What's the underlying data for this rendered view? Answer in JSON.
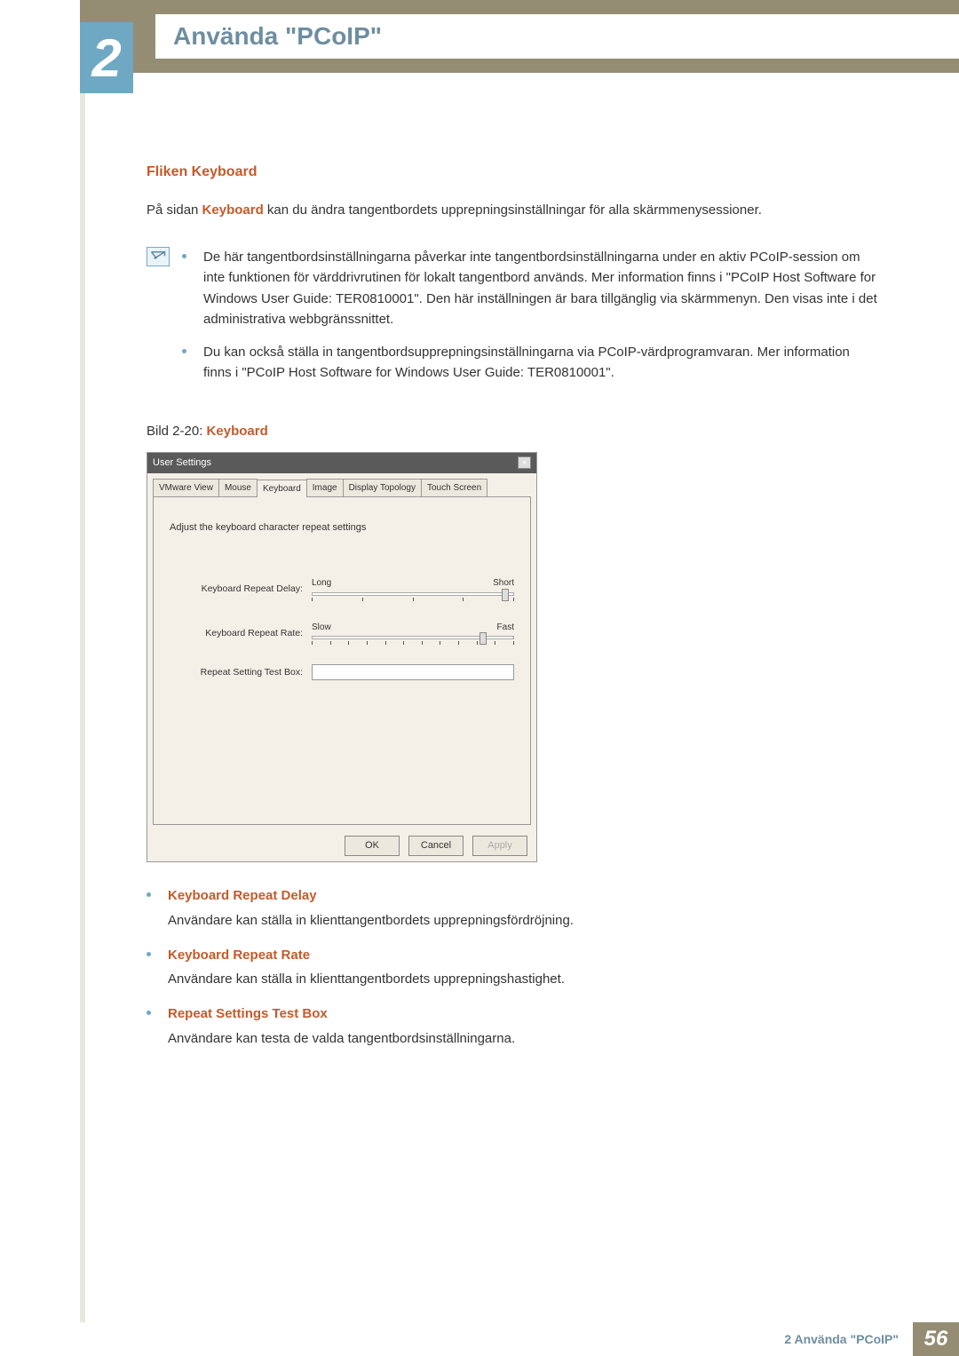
{
  "chapter": {
    "number": "2",
    "title": "Använda \"PCoIP\""
  },
  "section": {
    "title": "Fliken Keyboard"
  },
  "intro": {
    "prefix": "På sidan ",
    "bold": "Keyboard",
    "suffix": " kan du ändra tangentbordets upprepningsinställningar för alla skärmmenysessioner."
  },
  "notes": [
    "De här tangentbordsinställningarna påverkar inte tangentbordsinställningarna under en aktiv PCoIP-session om inte funktionen för värddrivrutinen för lokalt tangentbord används. Mer information finns i \"PCoIP Host Software for Windows User Guide: TER0810001\". Den här inställningen är bara tillgänglig via skärmmenyn. Den visas inte i det administrativa webbgränssnittet.",
    "Du kan också ställa in tangentbordsupprepningsinställningarna via PCoIP-värdprogramvaran. Mer information finns i \"PCoIP Host Software for Windows User Guide: TER0810001\"."
  ],
  "caption": {
    "prefix": "Bild 2-20: ",
    "bold": "Keyboard"
  },
  "dialog": {
    "title": "User Settings",
    "tabs": [
      "VMware View",
      "Mouse",
      "Keyboard",
      "Image",
      "Display Topology",
      "Touch Screen"
    ],
    "active_tab": "Keyboard",
    "instruction": "Adjust the keyboard character repeat settings",
    "rows": {
      "delay": {
        "label": "Keyboard Repeat Delay:",
        "left": "Long",
        "right": "Short",
        "thumb_pct": 96,
        "tick_count": 5
      },
      "rate": {
        "label": "Keyboard Repeat Rate:",
        "left": "Slow",
        "right": "Fast",
        "thumb_pct": 85,
        "tick_count": 12
      },
      "test": {
        "label": "Repeat Setting Test Box:"
      }
    },
    "buttons": {
      "ok": "OK",
      "cancel": "Cancel",
      "apply": "Apply"
    }
  },
  "definitions": [
    {
      "term": "Keyboard Repeat Delay",
      "desc": "Användare kan ställa in klienttangentbordets upprepningsfördröjning."
    },
    {
      "term": "Keyboard Repeat Rate",
      "desc": "Användare kan ställa in klienttangentbordets upprepningshastighet."
    },
    {
      "term": "Repeat Settings Test Box",
      "desc": "Användare kan testa de valda tangentbordsinställningarna."
    }
  ],
  "footer": {
    "label": "2 Använda \"PCoIP\"",
    "page": "56"
  }
}
